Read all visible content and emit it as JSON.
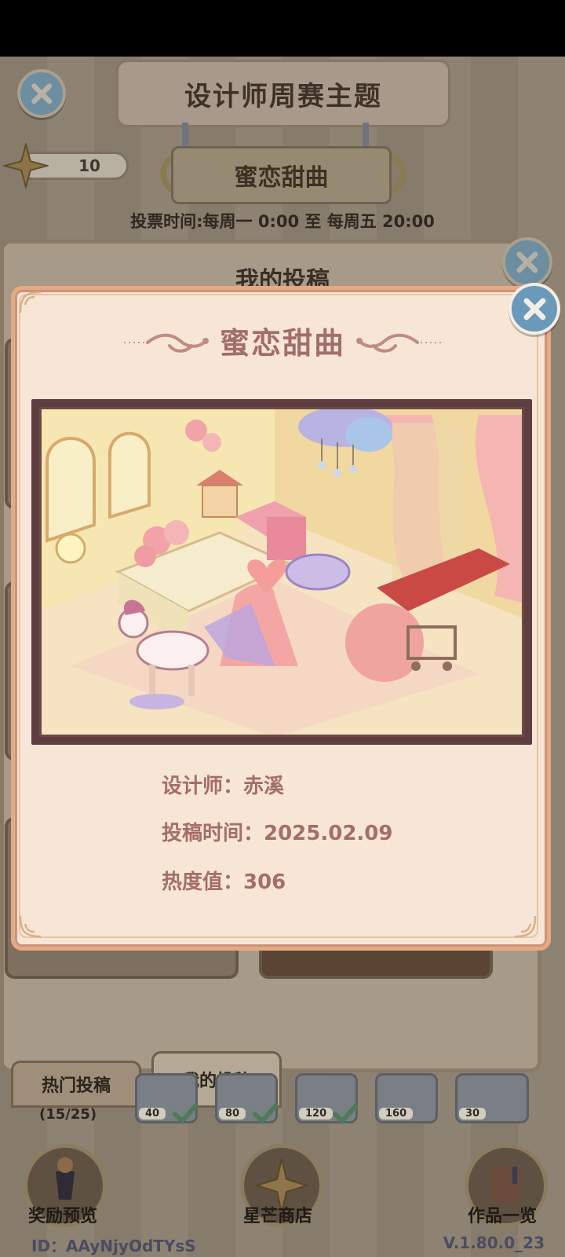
{
  "header": {
    "title": "设计师周赛主题",
    "theme": "蜜恋甜曲",
    "vote_time": "投票时间:每周一 0:00 至 每周五 20:00",
    "stars": "10"
  },
  "panel": {
    "title": "我的投稿"
  },
  "tabs": {
    "hot": "热门投稿",
    "mine": "我的投稿",
    "hot_count": "(15/25)"
  },
  "milestones": [
    {
      "value": "40",
      "done": true
    },
    {
      "value": "80",
      "done": true
    },
    {
      "value": "120",
      "done": true
    },
    {
      "value": "160",
      "done": false
    },
    {
      "value": "30",
      "done": false
    }
  ],
  "bottom_nav": {
    "rewards": "奖励预览",
    "shop": "星芒商店",
    "works": "作品一览"
  },
  "footer": {
    "id": "ID：AAyNjyOdTYsS",
    "version": "V.1.80.0_23"
  },
  "modal": {
    "title": "蜜恋甜曲",
    "designer": "设计师：赤溪",
    "submit_time": "投稿时间：2025.02.09",
    "heat": "热度值：306"
  },
  "colors": {
    "modal_bg": "#f7e6d6",
    "modal_border": "#e6a983",
    "title_text": "#a26e69",
    "close_button": "#6a99ba"
  },
  "icons": [
    "close-icon",
    "star-icon",
    "checkmark-icon",
    "trophy-icon",
    "book-icon",
    "flourish-ornament"
  ]
}
